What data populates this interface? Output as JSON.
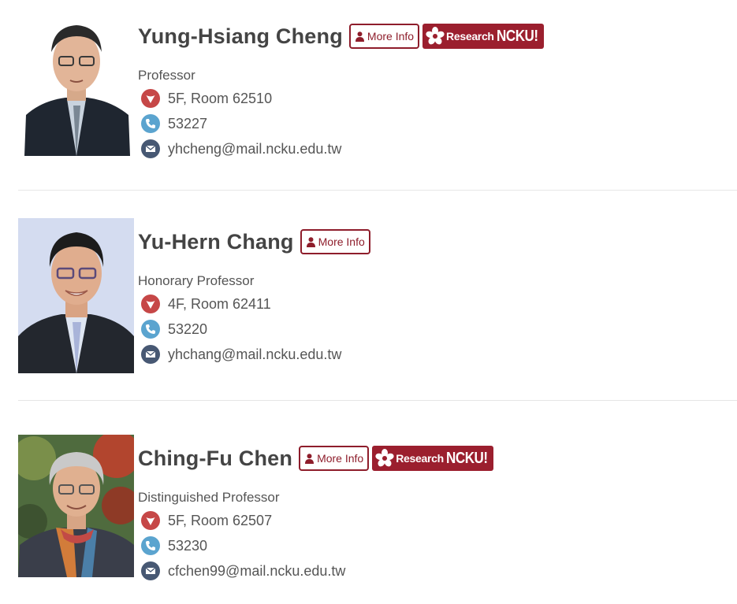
{
  "people": [
    {
      "name": "Yung-Hsiang Cheng",
      "title": "Professor",
      "room": "5F, Room 62510",
      "phone": "53227",
      "email": "yhcheng@mail.ncku.edu.tw",
      "more_info_label": "More Info",
      "research_badge": {
        "word1": "Research",
        "word2": "NCKU!"
      }
    },
    {
      "name": "Yu-Hern Chang",
      "title": "Honorary Professor",
      "room": "4F, Room 62411",
      "phone": "53220",
      "email": "yhchang@mail.ncku.edu.tw",
      "more_info_label": "More Info"
    },
    {
      "name": "Ching-Fu Chen",
      "title": "Distinguished Professor",
      "room": "5F, Room 62507",
      "phone": "53230",
      "email": "cfchen99@mail.ncku.edu.tw",
      "more_info_label": "More Info",
      "research_badge": {
        "word1": "Research",
        "word2": "NCKU!"
      }
    }
  ],
  "icons": {
    "more_info": "user-icon",
    "location": "location-marker-icon",
    "phone": "phone-icon",
    "email": "envelope-icon",
    "research": "ncku-flower-icon"
  },
  "colors": {
    "brand_red": "#8e1d2b",
    "location_icon": "#c64747",
    "phone_icon": "#5ba4cf",
    "email_icon": "#475873",
    "divider": "#e6e6e6"
  }
}
